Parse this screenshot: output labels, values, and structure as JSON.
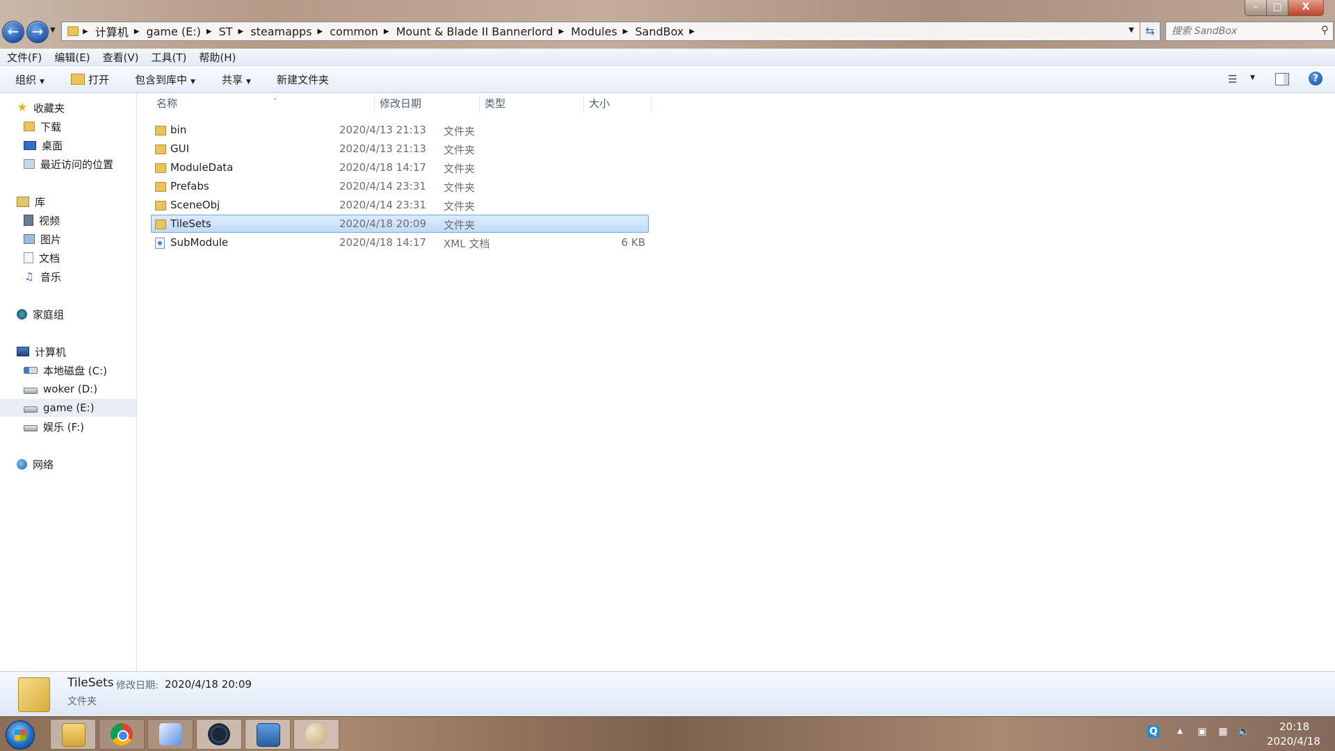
{
  "window": {
    "address_path": [
      "计算机",
      "game (E:)",
      "ST",
      "steamapps",
      "common",
      "Mount & Blade II Bannerlord",
      "Modules",
      "SandBox"
    ],
    "search_placeholder": "搜索 SandBox",
    "controls": {
      "minimize": "–",
      "maximize": "□",
      "close": "X"
    }
  },
  "menu": [
    "文件(F)",
    "编辑(E)",
    "查看(V)",
    "工具(T)",
    "帮助(H)"
  ],
  "toolbar": {
    "organize": "组织",
    "open": "打开",
    "include_in_library": "包含到库中",
    "share": "共享",
    "new_folder": "新建文件夹"
  },
  "nav": {
    "favorites": {
      "label": "收藏夹",
      "items": [
        "下载",
        "桌面",
        "最近访问的位置"
      ]
    },
    "libraries": {
      "label": "库",
      "items": [
        "视频",
        "图片",
        "文档",
        "音乐"
      ]
    },
    "homegroup": {
      "label": "家庭组"
    },
    "computer": {
      "label": "计算机",
      "items": [
        "本地磁盘 (C:)",
        "woker (D:)",
        "game (E:)",
        "娱乐 (F:)"
      ],
      "selected": "game (E:)"
    },
    "network": {
      "label": "网络"
    }
  },
  "columns": {
    "name": "名称",
    "modified": "修改日期",
    "type": "类型",
    "size": "大小"
  },
  "files": [
    {
      "name": "bin",
      "modified": "2020/4/13 21:13",
      "type": "文件夹",
      "size": "",
      "kind": "folder"
    },
    {
      "name": "GUI",
      "modified": "2020/4/13 21:13",
      "type": "文件夹",
      "size": "",
      "kind": "folder"
    },
    {
      "name": "ModuleData",
      "modified": "2020/4/18 14:17",
      "type": "文件夹",
      "size": "",
      "kind": "folder"
    },
    {
      "name": "Prefabs",
      "modified": "2020/4/14 23:31",
      "type": "文件夹",
      "size": "",
      "kind": "folder"
    },
    {
      "name": "SceneObj",
      "modified": "2020/4/14 23:31",
      "type": "文件夹",
      "size": "",
      "kind": "folder"
    },
    {
      "name": "TileSets",
      "modified": "2020/4/18 20:09",
      "type": "文件夹",
      "size": "",
      "kind": "folder",
      "selected": true
    },
    {
      "name": "SubModule",
      "modified": "2020/4/18 14:17",
      "type": "XML 文档",
      "size": "6 KB",
      "kind": "xml"
    }
  ],
  "details": {
    "name": "TileSets",
    "modified_label": "修改日期:",
    "modified": "2020/4/18 20:09",
    "type": "文件夹"
  },
  "taskbar": {
    "apps": [
      "file-explorer",
      "chrome",
      "bird-app",
      "steam",
      "photo-viewer",
      "paint"
    ],
    "tray": {
      "qq": "Q"
    },
    "clock": {
      "time": "20:18",
      "date": "2020/4/18"
    }
  }
}
